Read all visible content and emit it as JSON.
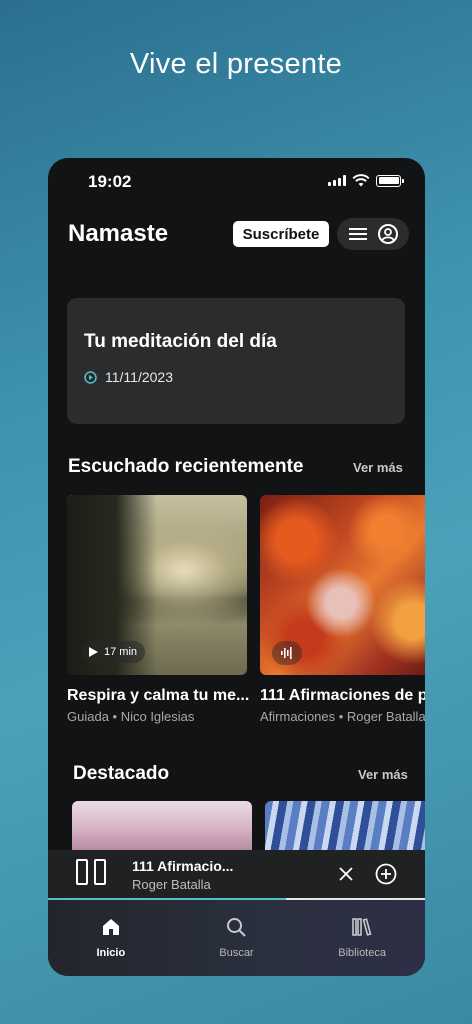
{
  "headline": "Vive el presente",
  "status": {
    "time": "19:02"
  },
  "header": {
    "title": "Namaste",
    "subscribe_label": "Suscríbete"
  },
  "daily": {
    "title": "Tu meditación del día",
    "date": "11/11/2023"
  },
  "recent": {
    "title": "Escuchado recientemente",
    "see_more": "Ver más",
    "items": [
      {
        "title": "Respira y calma tu me...",
        "subtitle": "Guiada • Nico Iglesias",
        "duration": "17 min"
      },
      {
        "title": "111 Afirmaciones de p",
        "subtitle": "Afirmaciones • Roger Batalla"
      }
    ]
  },
  "featured": {
    "title": "Destacado",
    "see_more": "Ver más"
  },
  "player": {
    "title": "111 Afirmacio...",
    "artist": "Roger Batalla",
    "progress": 0.63
  },
  "tabs": [
    {
      "label": "Inicio",
      "icon": "home-icon",
      "active": true
    },
    {
      "label": "Buscar",
      "icon": "search-icon",
      "active": false
    },
    {
      "label": "Biblioteca",
      "icon": "library-icon",
      "active": false
    }
  ],
  "colors": {
    "accent": "#52c1c7",
    "background": "#121314"
  }
}
